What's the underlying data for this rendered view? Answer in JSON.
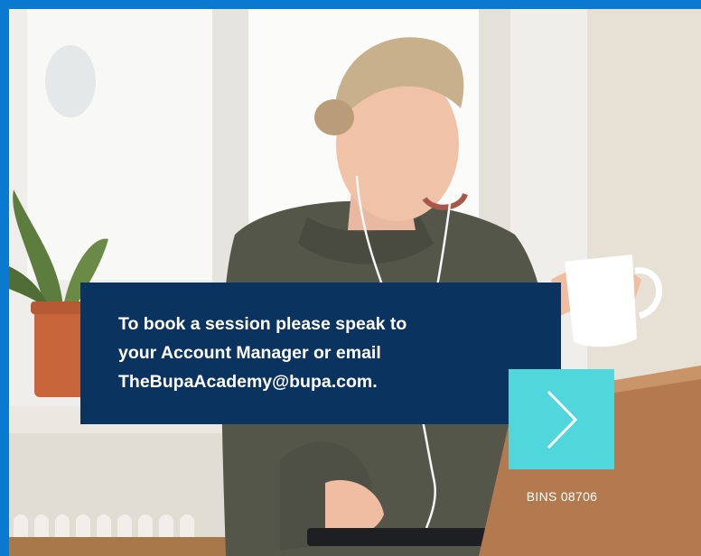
{
  "promo": {
    "line1": "To book a session please speak to",
    "line2": "your Account Manager or email",
    "line3": "TheBupaAcademy@bupa.com."
  },
  "next_button": {
    "icon": "chevron-right-icon"
  },
  "reference_code": "BINS 08706",
  "colors": {
    "frame_blue": "#0a7ad1",
    "callout_navy": "#0b3360",
    "button_teal": "#4fd7dc"
  }
}
